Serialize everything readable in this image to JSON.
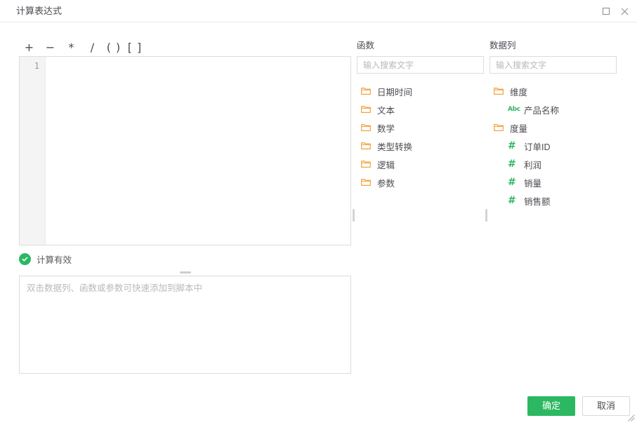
{
  "window": {
    "title": "计算表达式",
    "maximize_icon": "maximize-icon",
    "close_icon": "close-icon",
    "resize_grip_icon": "resize-grip-icon"
  },
  "toolbar": {
    "operators": [
      {
        "label": "+",
        "name": "operator-plus"
      },
      {
        "label": "−",
        "name": "operator-minus"
      },
      {
        "label": "*",
        "name": "operator-multiply"
      },
      {
        "label": "/",
        "name": "operator-divide"
      },
      {
        "label": "( )",
        "name": "operator-parentheses"
      },
      {
        "label": "[ ]",
        "name": "operator-brackets"
      }
    ]
  },
  "editor": {
    "line_numbers": [
      "1"
    ],
    "content": "",
    "placeholder": ""
  },
  "status": {
    "icon": "check-circle-icon",
    "text": "计算有效",
    "color": "#2cb862"
  },
  "script": {
    "value": "",
    "placeholder": "双击数据列、函数或参数可快速添加到脚本中"
  },
  "functions_panel": {
    "title": "函数",
    "search_placeholder": "输入搜索文字",
    "search_value": "",
    "items": [
      {
        "label": "日期时间",
        "icon": "folder-icon",
        "level": 1
      },
      {
        "label": "文本",
        "icon": "folder-icon",
        "level": 1
      },
      {
        "label": "数学",
        "icon": "folder-icon",
        "level": 1
      },
      {
        "label": "类型转换",
        "icon": "folder-icon",
        "level": 1
      },
      {
        "label": "逻辑",
        "icon": "folder-icon",
        "level": 1
      },
      {
        "label": "参数",
        "icon": "folder-icon",
        "level": 1
      }
    ]
  },
  "columns_panel": {
    "title": "数据列",
    "search_placeholder": "输入搜索文字",
    "search_value": "",
    "items": [
      {
        "label": "维度",
        "icon": "folder-icon",
        "level": 1
      },
      {
        "label": "产品名称",
        "icon": "abc-icon",
        "level": 2
      },
      {
        "label": "度量",
        "icon": "folder-icon",
        "level": 1
      },
      {
        "label": "订单ID",
        "icon": "hash-icon",
        "level": 2
      },
      {
        "label": "利润",
        "icon": "hash-icon",
        "level": 2
      },
      {
        "label": "销量",
        "icon": "hash-icon",
        "level": 2
      },
      {
        "label": "销售额",
        "icon": "hash-icon",
        "level": 2
      }
    ]
  },
  "footer": {
    "ok_label": "确定",
    "cancel_label": "取消"
  },
  "theme": {
    "accent": "#2cb862",
    "folder": "#f2a33c",
    "border": "#dcdcdf",
    "text": "#4b4b52"
  }
}
